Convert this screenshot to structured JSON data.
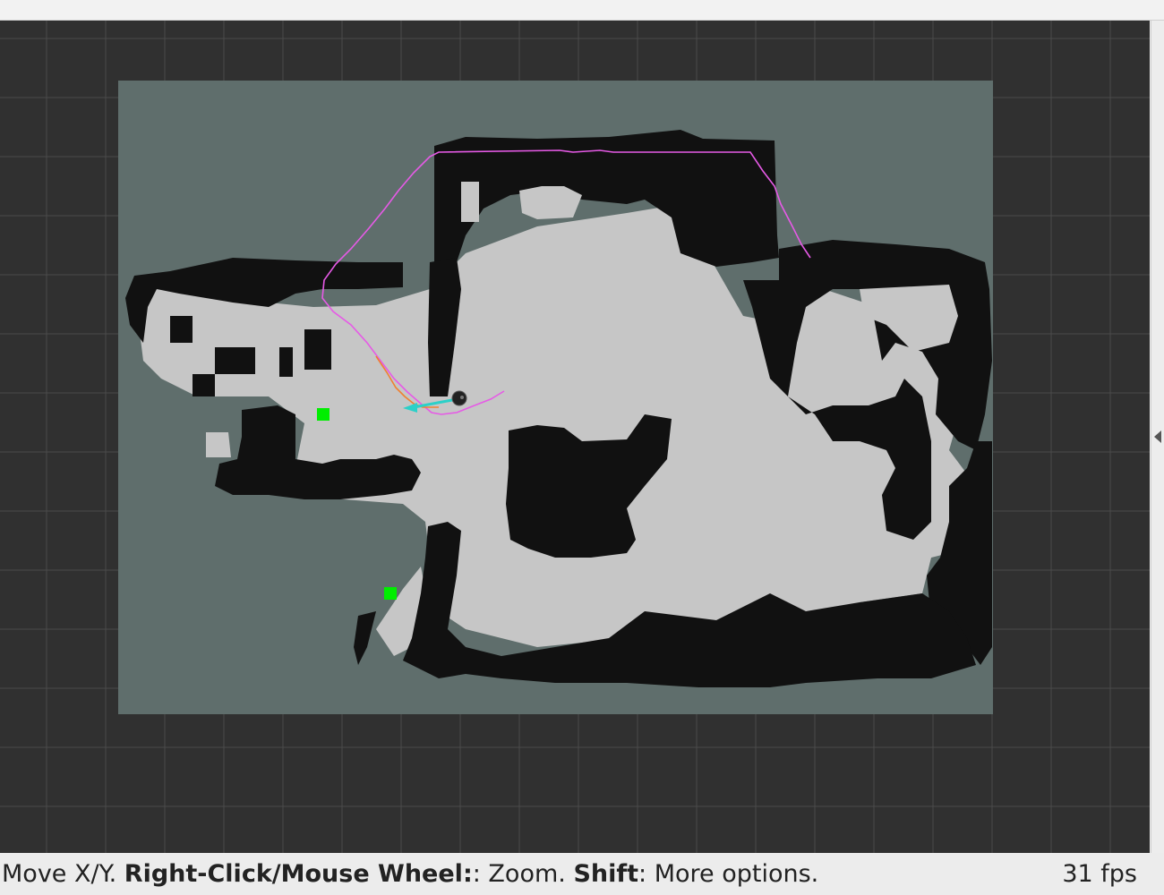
{
  "statusbar": {
    "hint_move": "Move X/Y. ",
    "hint_zoom_key": "Right-Click/Mouse Wheel:",
    "hint_zoom_text": ": Zoom. ",
    "hint_shift_key": "Shift",
    "hint_shift_text": ": More options.",
    "fps": "31 fps"
  },
  "view": {
    "background_color": "#303030",
    "grid_color": "#4a4a4a",
    "map_unknown_color": "#5f6e6c",
    "map_free_color": "#c6c6c6",
    "map_occupied_color": "#111111",
    "global_path_color": "#e65ae6",
    "local_path_color": "#f08030",
    "pose_arrow_color": "#2bd0c8",
    "marker_color": "#00ee00",
    "robot_color": "#222222"
  },
  "icons": {
    "side_panel_toggle": "triangle-left-icon"
  }
}
